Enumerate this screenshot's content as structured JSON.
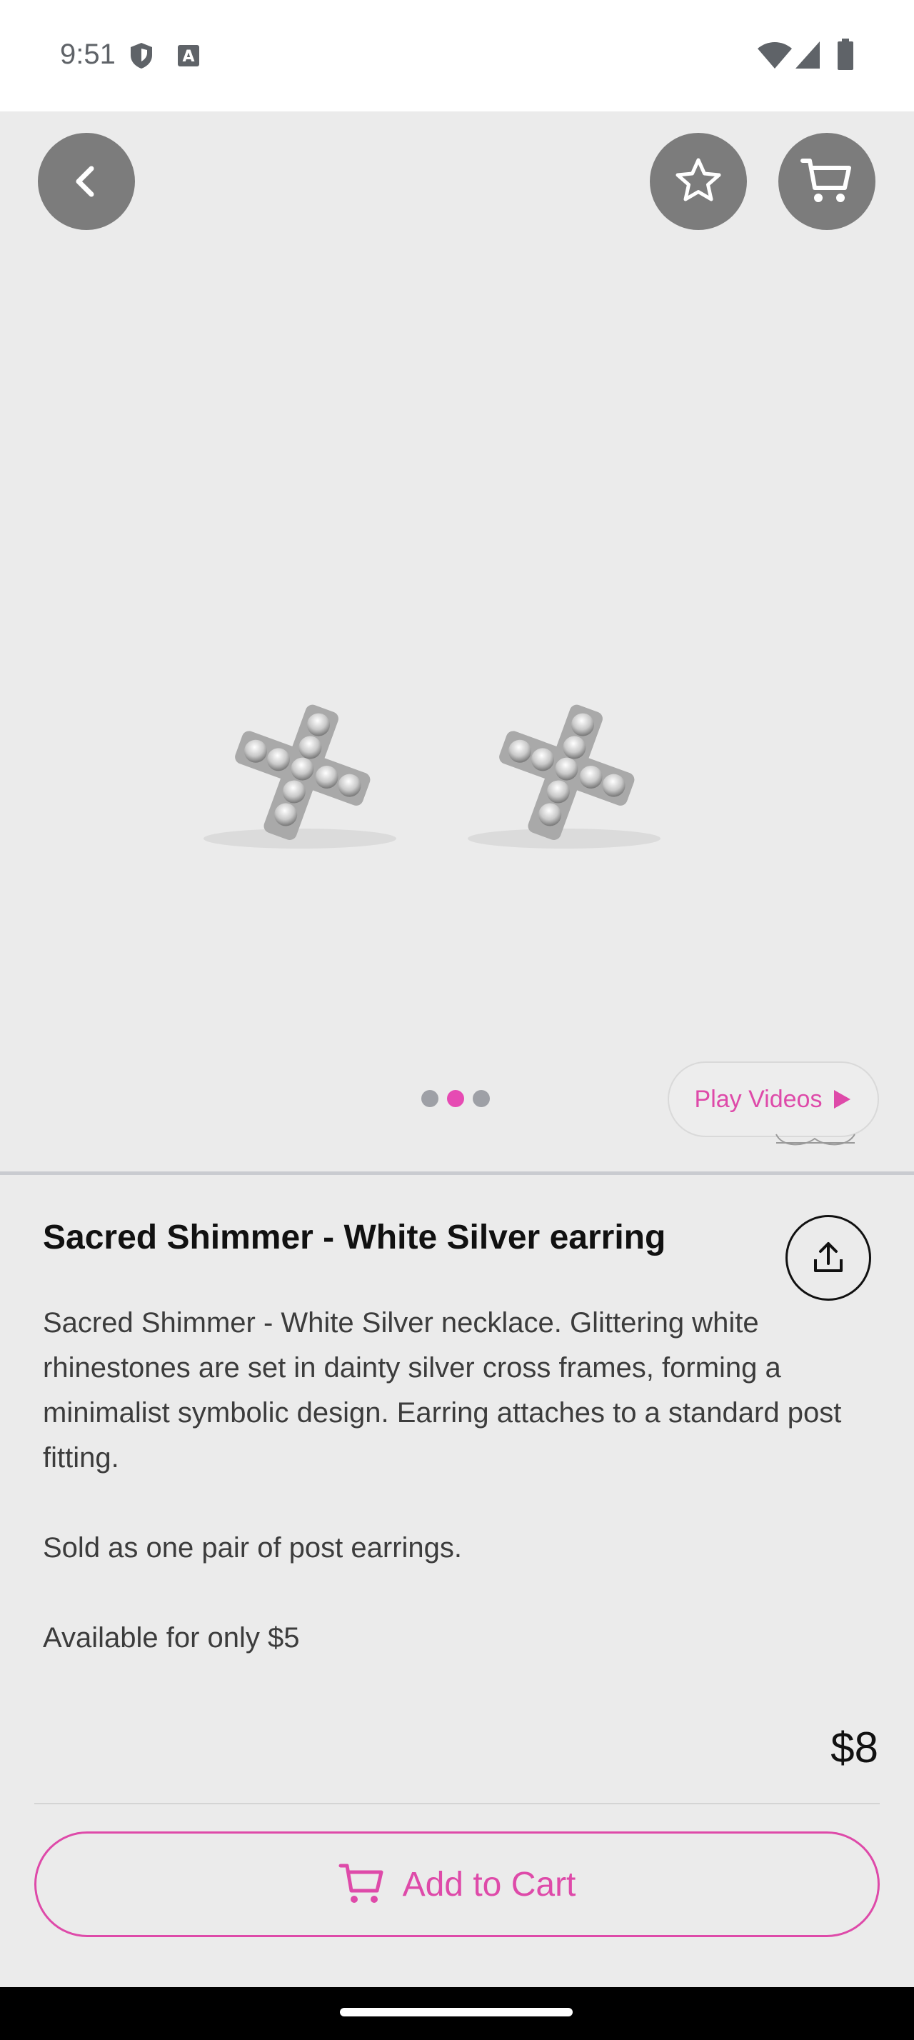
{
  "status_bar": {
    "time": "9:51",
    "icons": [
      "shield-icon",
      "keyboard-a-icon",
      "wifi-icon",
      "signal-icon",
      "battery-icon"
    ]
  },
  "hero": {
    "nav_buttons": [
      "back-chevron-icon",
      "star-icon",
      "cart-icon"
    ],
    "carousel": {
      "total": 3,
      "active_index": 1
    },
    "play_videos_label": "Play Videos"
  },
  "product": {
    "title": "Sacred Shimmer - White Silver earring",
    "description": [
      "Sacred Shimmer - White Silver necklace. Glittering white rhinestones are set in dainty silver cross frames, forming a minimalist symbolic design. Earring attaches to a standard post fitting.",
      "Sold as one pair of post earrings.",
      "Available for only $5"
    ],
    "price": "$8"
  },
  "footer": {
    "add_to_cart_label": "Add to Cart"
  },
  "colors": {
    "accent": "#de4aa9",
    "overlay_button": "#7c7c7c",
    "background": "#ebebeb"
  }
}
